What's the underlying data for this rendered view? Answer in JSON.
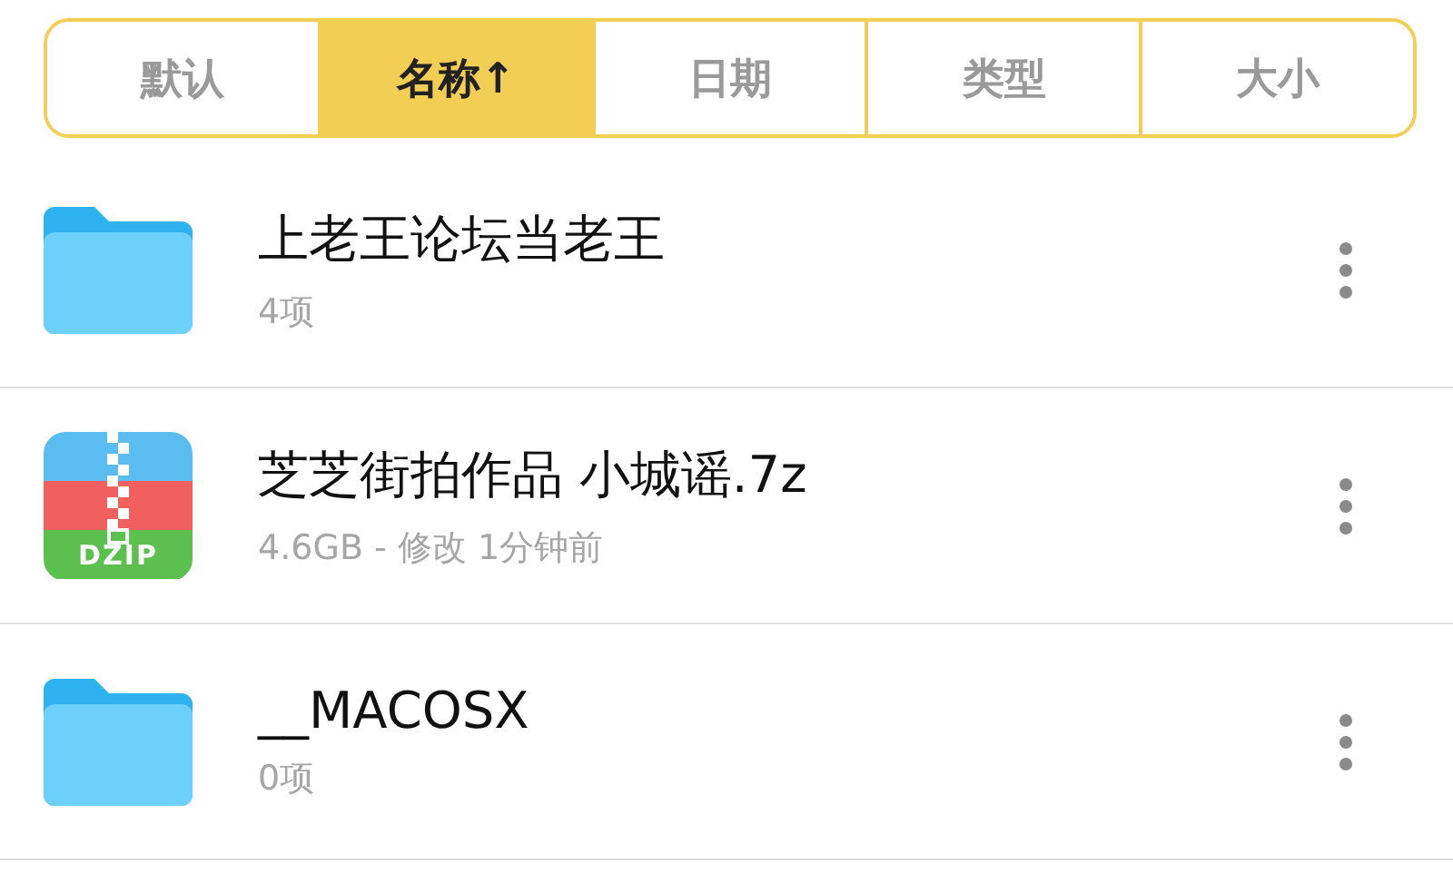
{
  "sort_tabs": [
    {
      "label": "默认",
      "selected": false
    },
    {
      "label": "名称↑",
      "selected": true
    },
    {
      "label": "日期",
      "selected": false
    },
    {
      "label": "类型",
      "selected": false
    },
    {
      "label": "大小",
      "selected": false
    }
  ],
  "files": [
    {
      "kind": "folder",
      "name": "上老王论坛当老王",
      "detail": "4项"
    },
    {
      "kind": "archive",
      "badge": "DZIP",
      "name": "芝芝街拍作品 小城谣.7z",
      "detail": "4.6GB - 修改 1分钟前"
    },
    {
      "kind": "folder",
      "name": "__MACOSX",
      "detail": "0项"
    }
  ]
}
